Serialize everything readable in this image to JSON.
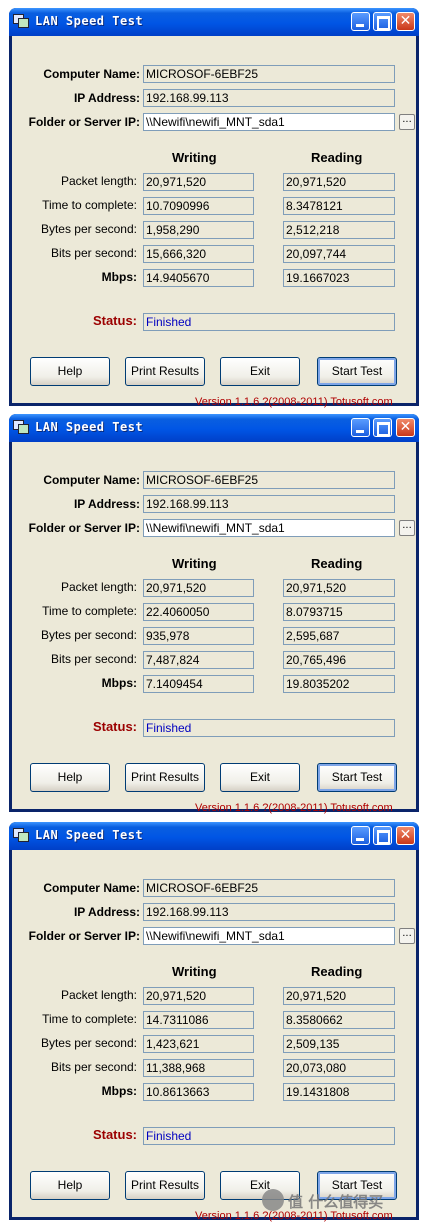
{
  "app": {
    "title": "LAN Speed Test"
  },
  "labels": {
    "computer_name": "Computer Name:",
    "ip_address": "IP Address:",
    "folder": "Folder or Server IP:",
    "writing": "Writing",
    "reading": "Reading",
    "packet_length": "Packet length:",
    "time_to_complete": "Time to complete:",
    "bytes_per_second": "Bytes per second:",
    "bits_per_second": "Bits per second:",
    "mbps": "Mbps:",
    "status": "Status:"
  },
  "buttons": {
    "help": "Help",
    "print": "Print Results",
    "exit": "Exit",
    "start": "Start Test"
  },
  "browse_label": "...",
  "watermark": "值 什么值得买",
  "windows": [
    {
      "computer_name": "MICROSOF-6EBF25",
      "ip_address": "192.168.99.113",
      "folder": "\\\\Newifi\\newifi_MNT_sda1",
      "writing": {
        "packet_length": "20,971,520",
        "time": "10.7090996",
        "bytes": "1,958,290",
        "bits": "15,666,320",
        "mbps": "14.9405670"
      },
      "reading": {
        "packet_length": "20,971,520",
        "time": "8.3478121",
        "bytes": "2,512,218",
        "bits": "20,097,744",
        "mbps": "19.1667023"
      },
      "status": "Finished",
      "version": "Version 1.1.6  ?(2008-2011) Totusoft.com"
    },
    {
      "computer_name": "MICROSOF-6EBF25",
      "ip_address": "192.168.99.113",
      "folder": "\\\\Newifi\\newifi_MNT_sda1",
      "writing": {
        "packet_length": "20,971,520",
        "time": "22.4060050",
        "bytes": "935,978",
        "bits": "7,487,824",
        "mbps": "7.1409454"
      },
      "reading": {
        "packet_length": "20,971,520",
        "time": "8.0793715",
        "bytes": "2,595,687",
        "bits": "20,765,496",
        "mbps": "19.8035202"
      },
      "status": "Finished",
      "version": "Version 1.1.6  ?(2008-2011) Totusoft.com"
    },
    {
      "computer_name": "MICROSOF-6EBF25",
      "ip_address": "192.168.99.113",
      "folder": "\\\\Newifi\\newifi_MNT_sda1",
      "writing": {
        "packet_length": "20,971,520",
        "time": "14.7311086",
        "bytes": "1,423,621",
        "bits": "11,388,968",
        "mbps": "10.8613663"
      },
      "reading": {
        "packet_length": "20,971,520",
        "time": "8.3580662",
        "bytes": "2,509,135",
        "bits": "20,073,080",
        "mbps": "19.1431808"
      },
      "status": "Finished",
      "version": "Version 1.1.6  ?(2008-2011) Totusoft.com"
    }
  ]
}
